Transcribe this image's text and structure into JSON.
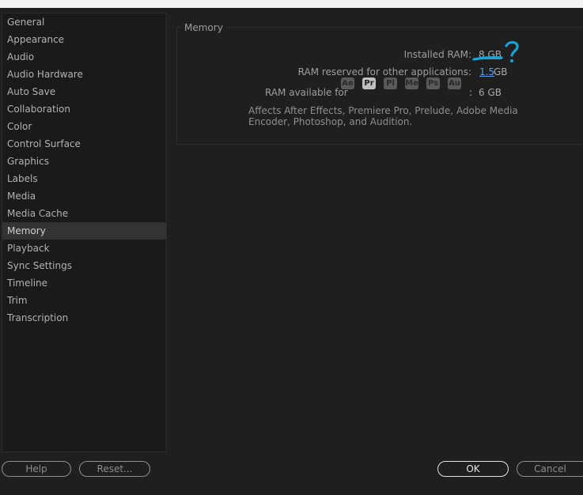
{
  "sidebar": {
    "items": [
      {
        "label": "General"
      },
      {
        "label": "Appearance"
      },
      {
        "label": "Audio"
      },
      {
        "label": "Audio Hardware"
      },
      {
        "label": "Auto Save"
      },
      {
        "label": "Collaboration"
      },
      {
        "label": "Color"
      },
      {
        "label": "Control Surface"
      },
      {
        "label": "Graphics"
      },
      {
        "label": "Labels"
      },
      {
        "label": "Media"
      },
      {
        "label": "Media Cache"
      },
      {
        "label": "Memory"
      },
      {
        "label": "Playback"
      },
      {
        "label": "Sync Settings"
      },
      {
        "label": "Timeline"
      },
      {
        "label": "Trim"
      },
      {
        "label": "Transcription"
      }
    ],
    "selected": "Memory"
  },
  "memory": {
    "group_title": "Memory",
    "installed_label": "Installed RAM:",
    "installed_value": "8 GB",
    "reserved_label": "RAM reserved for other applications:",
    "reserved_value": "1.5",
    "reserved_unit": "GB",
    "available_label": "RAM available for",
    "apps": [
      {
        "abbr": "Ae",
        "active": false
      },
      {
        "abbr": "Pr",
        "active": true
      },
      {
        "abbr": "Pl",
        "active": false
      },
      {
        "abbr": "Me",
        "active": false
      },
      {
        "abbr": "Ps",
        "active": false
      },
      {
        "abbr": "Au",
        "active": false
      }
    ],
    "available_sep": ":",
    "available_value": "6 GB",
    "note": "Affects After Effects, Premiere Pro, Prelude, Adobe Media Encoder, Photoshop, and Audition."
  },
  "annotation": {
    "glyph": "?",
    "color": "#19a3d6"
  },
  "buttons": {
    "help": "Help",
    "reset": "Reset...",
    "ok": "OK",
    "cancel": "Cancel"
  }
}
